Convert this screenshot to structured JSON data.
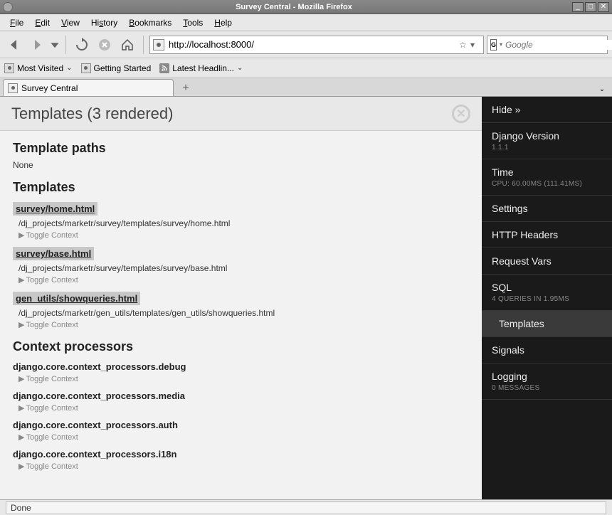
{
  "window": {
    "title": "Survey Central - Mozilla Firefox"
  },
  "menu": {
    "items": [
      "File",
      "Edit",
      "View",
      "History",
      "Bookmarks",
      "Tools",
      "Help"
    ]
  },
  "url": "http://localhost:8000/",
  "search": {
    "engine_label": "G",
    "placeholder": "Google"
  },
  "bookmarks": {
    "most_visited": "Most Visited",
    "getting_started": "Getting Started",
    "latest_headlines": "Latest Headlin..."
  },
  "tab": {
    "title": "Survey Central"
  },
  "panel": {
    "header": "Templates (3 rendered)",
    "paths_heading": "Template paths",
    "paths_value": "None",
    "templates_heading": "Templates",
    "templates": [
      {
        "name": "survey/home.html",
        "path": "/dj_projects/marketr/survey/templates/survey/home.html"
      },
      {
        "name": "survey/base.html",
        "path": "/dj_projects/marketr/survey/templates/survey/base.html"
      },
      {
        "name": "gen_utils/showqueries.html",
        "path": "/dj_projects/marketr/gen_utils/templates/gen_utils/showqueries.html"
      }
    ],
    "toggle_context": "Toggle Context",
    "cp_heading": "Context processors",
    "context_processors": [
      "django.core.context_processors.debug",
      "django.core.context_processors.media",
      "django.core.context_processors.auth",
      "django.core.context_processors.i18n"
    ]
  },
  "sidebar": {
    "items": [
      {
        "label": "Hide »",
        "sub": ""
      },
      {
        "label": "Django Version",
        "sub": "1.1.1"
      },
      {
        "label": "Time",
        "sub": "CPU: 60.00MS (111.41MS)"
      },
      {
        "label": "Settings",
        "sub": ""
      },
      {
        "label": "HTTP Headers",
        "sub": ""
      },
      {
        "label": "Request Vars",
        "sub": ""
      },
      {
        "label": "SQL",
        "sub": "4 QUERIES IN 1.95MS"
      },
      {
        "label": "Templates",
        "sub": "",
        "active": true
      },
      {
        "label": "Signals",
        "sub": ""
      },
      {
        "label": "Logging",
        "sub": "0 MESSAGES"
      }
    ]
  },
  "status": "Done"
}
